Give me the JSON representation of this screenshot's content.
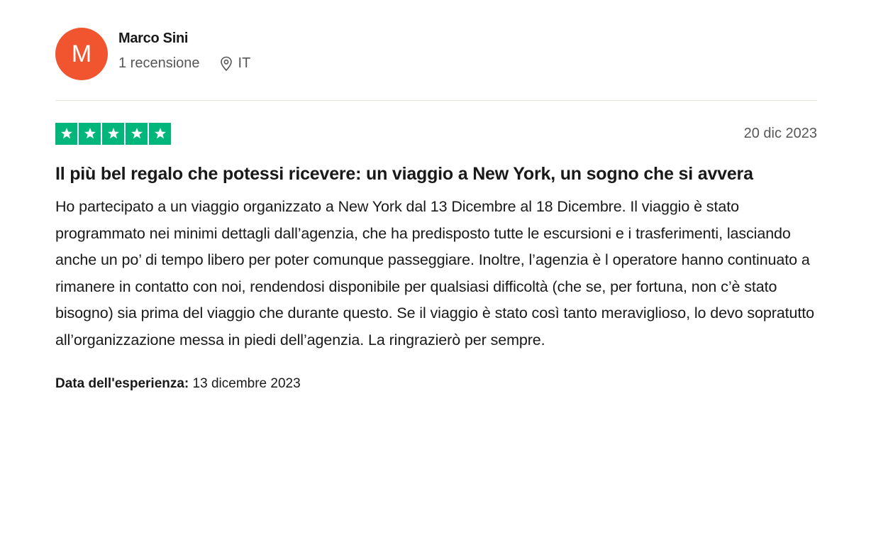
{
  "reviewer": {
    "initial": "M",
    "name": "Marco Sini",
    "reviews_count": "1 recensione",
    "location": "IT",
    "avatar_color": "#f1552f"
  },
  "review": {
    "rating": 5,
    "max_rating": 5,
    "star_color": "#00b67a",
    "date": "20 dic 2023",
    "title": "Il più bel regalo che potessi ricevere: un viaggio a New York, un sogno che si avvera",
    "body": "Ho partecipato a un viaggio organizzato a New York dal 13 Dicembre al 18 Dicembre. Il viaggio è stato programmato nei minimi dettagli dall’agenzia, che ha predisposto tutte le escursioni e i trasferimenti, lasciando anche un po’ di tempo libero per poter comunque passeggiare. Inoltre, l’agenzia è l operatore hanno continuato a rimanere in contatto con noi, rendendosi disponibile per qualsiasi difficoltà (che se, per fortuna, non c’è stato bisogno) sia prima del viaggio che durante questo. Se il viaggio è stato così tanto meraviglioso, lo devo sopratutto all’organizzazione messa in piedi dell’agenzia. La ringrazierò per sempre.",
    "experience_label": "Data dell'esperienza:",
    "experience_date": "13 dicembre 2023"
  },
  "icons": {
    "location": "location-pin-icon",
    "star": "star-icon"
  }
}
